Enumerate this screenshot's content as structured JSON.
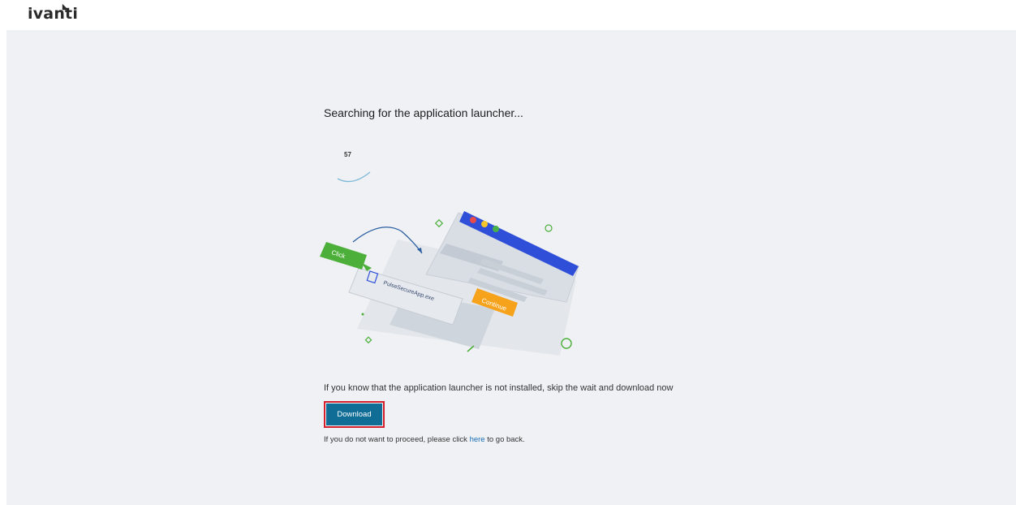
{
  "header": {
    "logo_text": "ivanti"
  },
  "main": {
    "title": "Searching for the application launcher...",
    "spinner_count": "57",
    "illustration": {
      "click_label": "Click",
      "file_label": "PulseSecureApp.exe",
      "continue_label": "Continue"
    },
    "hint": "If you know that the application launcher is not installed, skip the wait and download now",
    "download_label": "Download",
    "back_prefix": "If you do not want to proceed, please click ",
    "back_link": "here",
    "back_suffix": " to go back."
  },
  "colors": {
    "panel_bg": "#eff1f4",
    "button_bg": "#0f6d96",
    "highlight_border": "#d4202c",
    "link": "#1a6fb3",
    "accent_blue": "#2f4fd9",
    "accent_green": "#4caf39",
    "accent_orange": "#f7a21b"
  }
}
